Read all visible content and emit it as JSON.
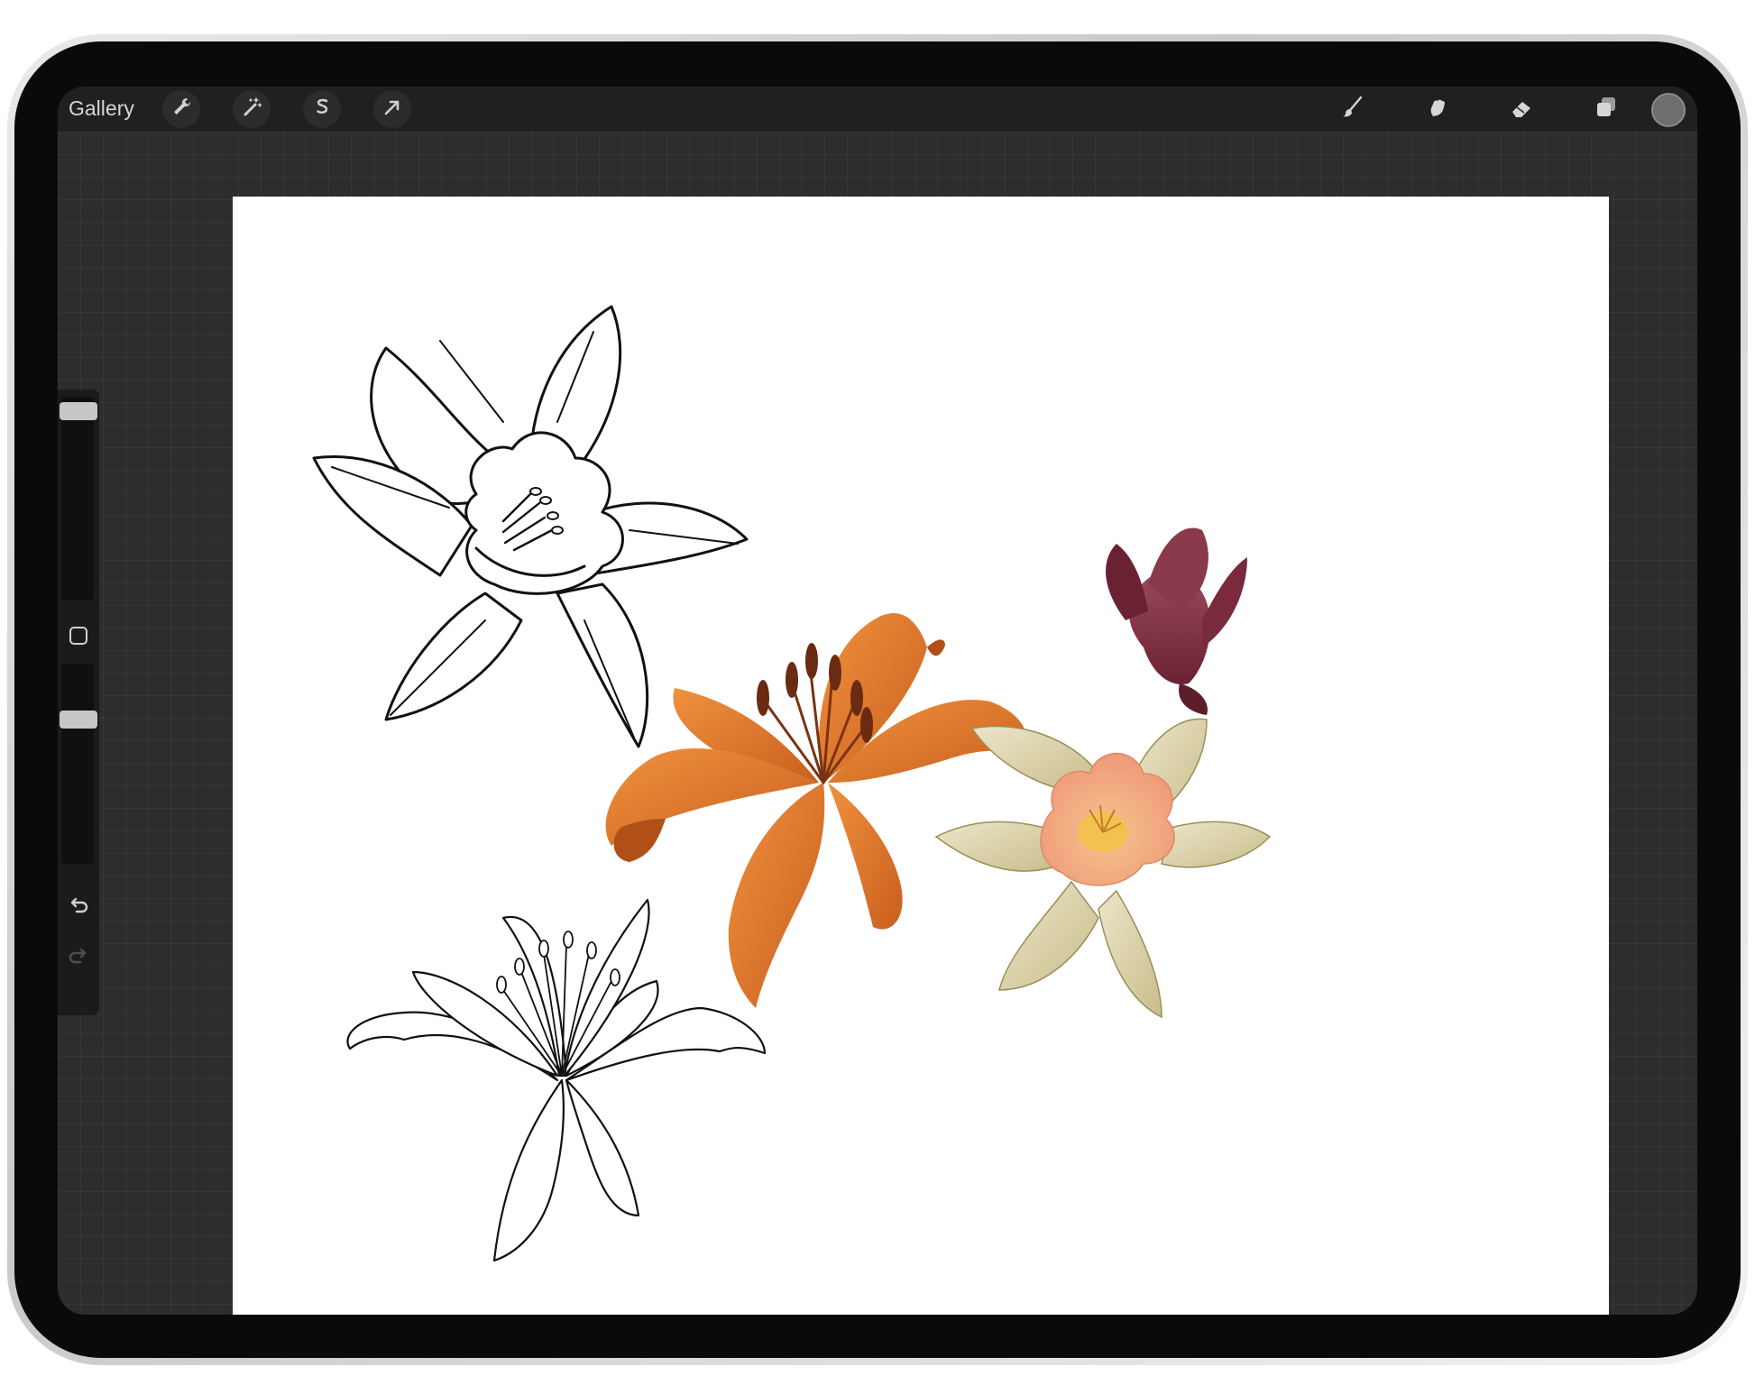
{
  "app": {
    "gallery_label": "Gallery"
  },
  "toolbar": {
    "left_tools": [
      {
        "name": "actions",
        "icon": "wrench-icon"
      },
      {
        "name": "adjustments",
        "icon": "magic-wand-icon"
      },
      {
        "name": "selection",
        "icon": "selection-s-icon"
      },
      {
        "name": "transform",
        "icon": "arrow-cursor-icon"
      }
    ],
    "right_tools": [
      {
        "name": "brush",
        "icon": "brush-icon"
      },
      {
        "name": "smudge",
        "icon": "smudge-finger-icon"
      },
      {
        "name": "eraser",
        "icon": "eraser-icon"
      },
      {
        "name": "layers",
        "icon": "layers-icon"
      }
    ],
    "current_color": "#6e6e6e"
  },
  "sidebar": {
    "brush_size_level": 0.0,
    "brush_opacity_level": 0.0,
    "modify_button_icon": "square-icon",
    "undo_icon": "undo-icon",
    "redo_icon": "redo-icon"
  },
  "colors": {
    "screen_bg": "#2d2d2d",
    "topbar_bg": "#202020",
    "canvas_bg": "#ffffff",
    "lily_orange": "#e07a2c",
    "lily_dark": "#b04f17",
    "bud_purple": "#7a2a3d",
    "daffodil_cream": "#d8cfa6",
    "daffodil_peach": "#f2a884"
  }
}
